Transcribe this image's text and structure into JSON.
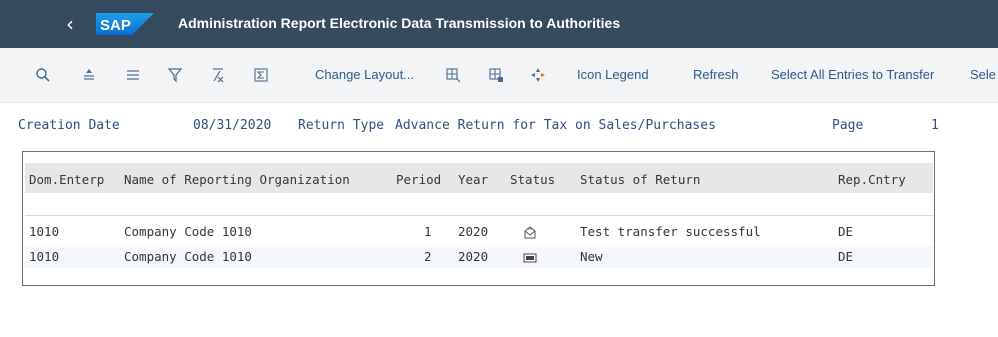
{
  "shell": {
    "back_icon": "chevron-left-icon",
    "logo": "SAP",
    "title": "Administration Report Electronic Data Transmission to Authorities"
  },
  "toolbar": {
    "icons": [
      "zoom-icon",
      "align-center-icon",
      "align-left-icon",
      "filter-icon",
      "clear-filter-icon",
      "sum-icon"
    ],
    "change_layout": "Change Layout...",
    "icons2": [
      "column-layout-icon",
      "column-layout-alt-icon",
      "navigate-icon"
    ],
    "icon_legend": "Icon Legend",
    "refresh": "Refresh",
    "select_all": "Select All Entries to Transfer",
    "select_cut": "Sele"
  },
  "header": {
    "creation_date_label": "Creation Date",
    "creation_date_value": "08/31/2020",
    "return_type_label": "Return Type",
    "return_type_value": "Advance Return for Tax on Sales/Purchases",
    "page_label": "Page",
    "page_value": "1"
  },
  "table": {
    "columns": [
      "Dom.Enterp",
      "Name of Reporting Organization",
      "Period",
      "Year",
      "Status",
      "Status of Return",
      "Rep.Cntry"
    ],
    "rows": [
      {
        "dom": "1010",
        "name": "Company Code 1010",
        "period": "1",
        "year": "2020",
        "status_icon": "envelope-sent-icon",
        "status_text": "Test transfer successful",
        "country": "DE"
      },
      {
        "dom": "1010",
        "name": "Company Code 1010",
        "period": "2",
        "year": "2020",
        "status_icon": "new-document-icon",
        "status_text": "New",
        "country": "DE"
      }
    ]
  },
  "colors": {
    "shell_bg": "#354a5f",
    "toolbar_bg": "#f2f4f6",
    "link_blue": "#2a5b8f",
    "header_row_bg": "#e7e7e7"
  }
}
